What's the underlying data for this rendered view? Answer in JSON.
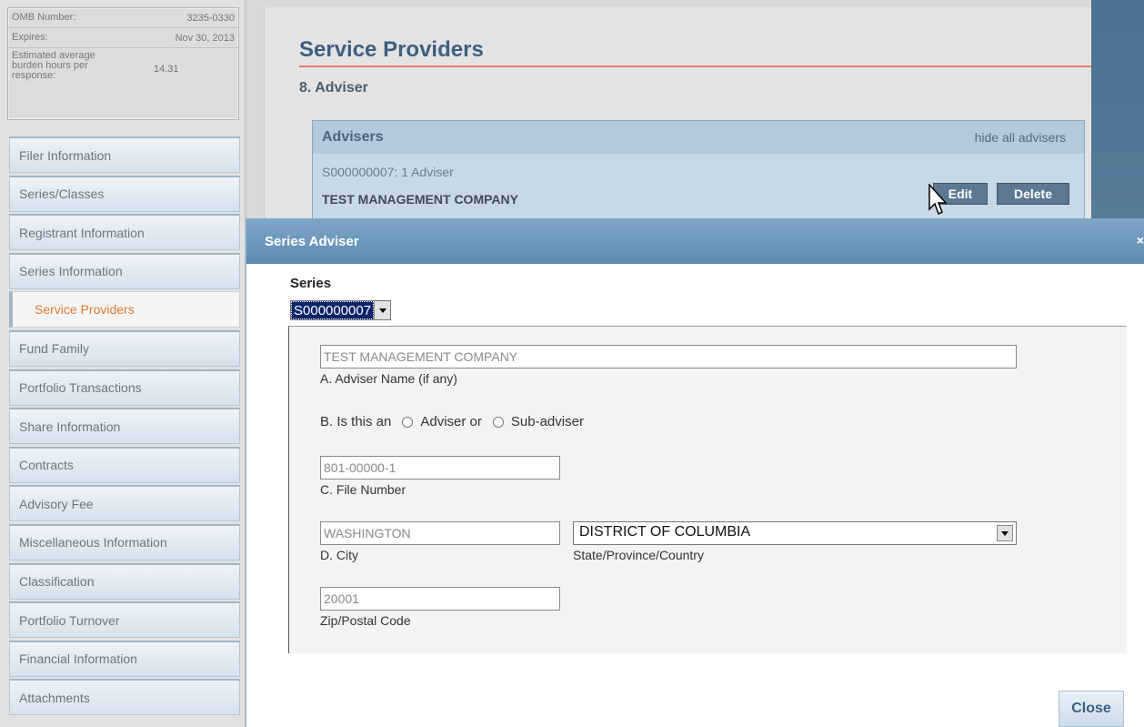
{
  "omb": {
    "number_label": "OMB Number:",
    "number_value": "3235-0330",
    "expires_label": "Expires:",
    "expires_value": "Nov 30, 2013",
    "burden_label": "Estimated average burden hours per response:",
    "burden_value": "14.31"
  },
  "sidebar": {
    "items": [
      {
        "label": "Filer Information"
      },
      {
        "label": "Series/Classes"
      },
      {
        "label": "Registrant Information"
      },
      {
        "label": "Series Information"
      },
      {
        "label": "Service Providers",
        "active": true
      },
      {
        "label": "Fund Family"
      },
      {
        "label": "Portfolio Transactions"
      },
      {
        "label": "Share Information"
      },
      {
        "label": "Contracts"
      },
      {
        "label": "Advisory Fee"
      },
      {
        "label": "Miscellaneous Information"
      },
      {
        "label": "Classification"
      },
      {
        "label": "Portfolio Turnover"
      },
      {
        "label": "Financial Information"
      },
      {
        "label": "Attachments"
      }
    ]
  },
  "main": {
    "title": "Service Providers",
    "subtitle": "8. Adviser",
    "advisers_panel": {
      "title": "Advisers",
      "hide_all": "hide all advisers",
      "series_line": "S000000007: 1 Adviser",
      "company": "TEST MANAGEMENT COMPANY",
      "edit_label": "Edit",
      "delete_label": "Delete"
    }
  },
  "modal": {
    "title": "Series Adviser",
    "close_x": "×",
    "series_label": "Series",
    "series_value": "S000000007",
    "adviser_name_value": "TEST MANAGEMENT COMPANY",
    "adviser_name_label": "A. Adviser Name (if any)",
    "type_prefix": "B. Is this an",
    "type_option_1": "Adviser or",
    "type_option_2": "Sub-adviser",
    "file_number_value": "801-00000-1",
    "file_number_label": "C. File Number",
    "city_value": "WASHINGTON",
    "city_label": "D. City",
    "state_value": "DISTRICT OF COLUMBIA",
    "state_label": "State/Province/Country",
    "zip_value": "20001",
    "zip_label": "Zip/Postal Code",
    "close_label": "Close"
  },
  "colors": {
    "title_blue": "#3d5f80",
    "active_nav": "#e07b2e",
    "header_blue": "#5e8ab0",
    "rule_red": "#e77a70"
  }
}
